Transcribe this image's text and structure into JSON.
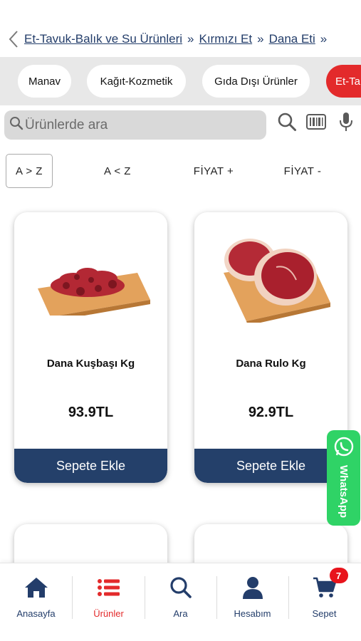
{
  "breadcrumb": {
    "items": [
      "Et-Tavuk-Balık ve Su Ürünleri",
      "Kırmızı Et",
      "Dana Eti"
    ],
    "separator": "»"
  },
  "categories": [
    {
      "label": "Manav",
      "active": false
    },
    {
      "label": "Kağıt-Kozmetik",
      "active": false
    },
    {
      "label": "Gıda Dışı Ürünler",
      "active": false
    },
    {
      "label": "Et-Ta",
      "active": true
    }
  ],
  "search": {
    "placeholder": "Ürünlerde ara",
    "icons": [
      "search-icon",
      "barcode-icon",
      "microphone-icon"
    ]
  },
  "sort": {
    "options": [
      "A > Z",
      "A < Z",
      "FİYAT +",
      "FİYAT -"
    ],
    "selected": "A > Z"
  },
  "products": [
    {
      "name": "Dana Kuşbaşı Kg",
      "price": "93.9TL",
      "button": "Sepete Ekle"
    },
    {
      "name": "Dana Rulo Kg",
      "price": "92.9TL",
      "button": "Sepete Ekle"
    }
  ],
  "whatsapp": {
    "label": "WhatsApp",
    "color": "#2fd366"
  },
  "nav": {
    "items": [
      {
        "label": "Anasayfa",
        "icon": "home-icon"
      },
      {
        "label": "Ürünler",
        "icon": "list-icon",
        "active": true
      },
      {
        "label": "Ara",
        "icon": "search-icon"
      },
      {
        "label": "Hesabım",
        "icon": "user-icon"
      },
      {
        "label": "Sepet",
        "icon": "cart-icon"
      }
    ],
    "cart_count": "7"
  },
  "colors": {
    "primary": "#24406a",
    "accent": "#e32a2b",
    "link": "#233d6a"
  }
}
